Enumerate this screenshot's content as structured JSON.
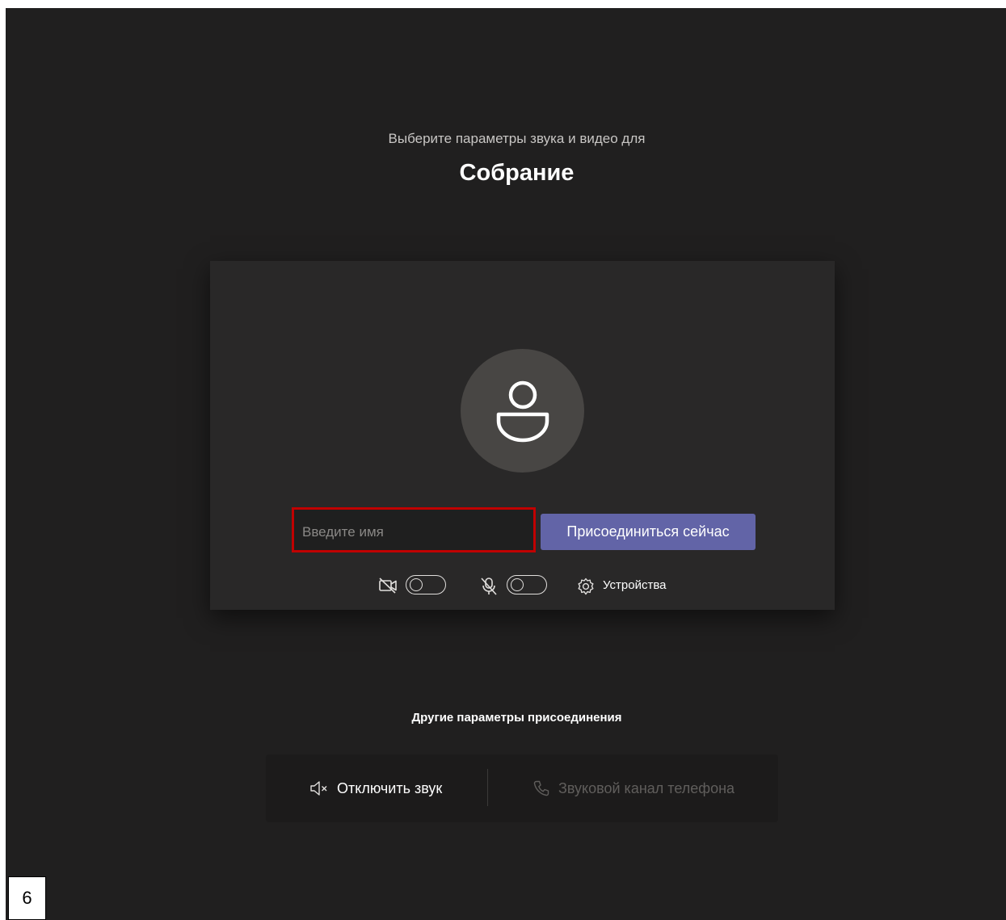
{
  "prejoin": {
    "subtitle": "Выберите параметры звука и видео для",
    "title": "Собрание",
    "name_placeholder": "Введите имя",
    "join_label": "Присоединиться сейчас",
    "controls": {
      "camera_icon": "camera-off-icon",
      "camera_on": false,
      "mic_icon": "mic-off-icon",
      "mic_on": false,
      "devices_icon": "gear-icon",
      "devices_label": "Устройства"
    }
  },
  "other_options": {
    "title": "Другие параметры присоединения",
    "mute_audio": {
      "icon": "speaker-off-icon",
      "label": "Отключить звук"
    },
    "phone_audio": {
      "icon": "phone-icon",
      "label": "Звуковой канал телефона",
      "disabled": true
    }
  },
  "page_number": "6",
  "colors": {
    "background": "#201f1f",
    "card": "#292828",
    "accent": "#6264a7",
    "highlight_border": "#c00000",
    "disabled_text": "#605e5c"
  }
}
